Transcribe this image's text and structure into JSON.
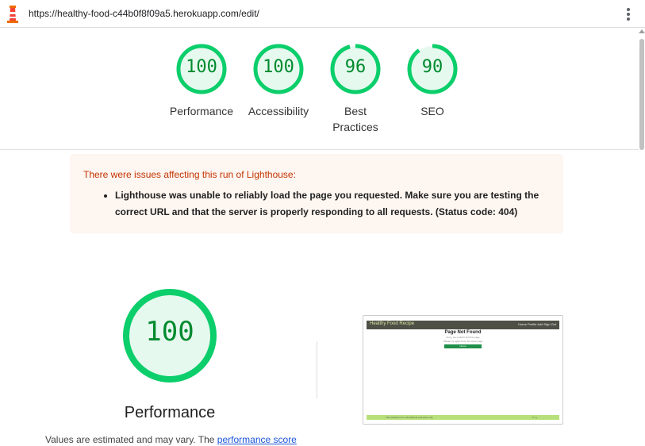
{
  "header": {
    "url": "https://healthy-food-c44b0f8f09a5.herokuapp.com/edit/",
    "logo_icon": "lighthouse-icon",
    "menu_icon": "kebab-menu-icon"
  },
  "scores": [
    {
      "value": "100",
      "score": 1.0,
      "label": "Performance"
    },
    {
      "value": "100",
      "score": 1.0,
      "label": "Accessibility"
    },
    {
      "value": "96",
      "score": 0.96,
      "label": "Best Practices"
    },
    {
      "value": "90",
      "score": 0.9,
      "label": "SEO"
    }
  ],
  "colors": {
    "pass": "#0cce6b",
    "pass_bg": "#e6f9ef",
    "pass_text": "#008a2e",
    "warning_bg": "#fef6f1",
    "warning_text": "#c33300",
    "link": "#1a56db"
  },
  "warning": {
    "title": "There were issues affecting this run of Lighthouse:",
    "items": [
      "Lighthouse was unable to reliably load the page you requested. Make sure you are testing the correct URL and that the server is properly responding to all requests. (Status code: 404)"
    ]
  },
  "performance": {
    "score": "100",
    "score_fraction": 1.0,
    "title": "Performance",
    "note_text": "Values are estimated and may vary. The",
    "note_link": "performance score"
  },
  "screenshot": {
    "brand": "Healthy Food Recipe",
    "nav": "Home  Profile  Add  Sign Out",
    "heading": "Page Not Found",
    "text1": "Sorry, we couldn't find this page",
    "text2": "Please try again from the home page",
    "button": "Home",
    "footer_text": "This website is for educational purposes only",
    "footer_icons": "f  t  i  y"
  }
}
